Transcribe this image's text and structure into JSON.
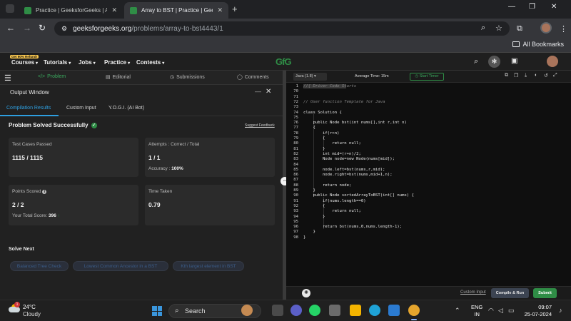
{
  "browser": {
    "tabs": [
      {
        "title": "Practice | GeeksforGeeks | A co",
        "active": false
      },
      {
        "title": "Array to BST | Practice | Geeksfo",
        "active": true
      }
    ],
    "url_domain": "geeksforgeeks.org",
    "url_path": "/problems/array-to-bst4443/1",
    "bookmarks_label": "All Bookmarks"
  },
  "site_nav": {
    "badge": "Get 90% Refund!",
    "items": [
      "Courses",
      "Tutorials",
      "Jobs",
      "Practice",
      "Contests"
    ],
    "logo": "GfG"
  },
  "problem_tabs": [
    "Problem",
    "Editorial",
    "Submissions",
    "Comments"
  ],
  "output_window": {
    "title": "Output Window",
    "tabs": [
      "Compilation Results",
      "Custom Input",
      "Y.O.G.I. (AI Bot)"
    ],
    "status": "Problem Solved Successfully",
    "feedback_link": "Suggest Feedback",
    "cards": {
      "test_cases": {
        "label": "Test Cases Passed",
        "value": "1115 / 1115"
      },
      "attempts": {
        "label": "Attempts : Correct / Total",
        "value": "1 / 1",
        "sub_label": "Accuracy :",
        "sub_value": "100%"
      },
      "points": {
        "label": "Points Scored",
        "value": "2 / 2",
        "sub_label": "Your Total Score:",
        "sub_value": "396"
      },
      "time": {
        "label": "Time Taken",
        "value": "0.79"
      }
    },
    "solve_next_title": "Solve Next",
    "solve_next": [
      "Balanced Tree Check",
      "Lowest Common Ancestor in a BST",
      "Kth largest element in BST"
    ]
  },
  "editor": {
    "language": "Java (1.8)",
    "average_time": "Average Time: 15m",
    "timer_label": "Start Timer",
    "line_numbers": [
      "1",
      "70",
      "71",
      "72",
      "73",
      "74",
      "75",
      "76",
      "77",
      "78",
      "79",
      "80",
      "81",
      "82",
      "83",
      "84",
      "85",
      "86",
      "87",
      "88",
      "89",
      "90",
      "91",
      "92",
      "93",
      "94",
      "95",
      "96",
      "97",
      "98"
    ],
    "lines": [
      "//{ Driver Code Starts",
      "",
      "",
      "// User function Template for Java",
      "",
      "class Solution {",
      "",
      "    public Node bst(int nums[],int r,int n)",
      "    {",
      "        if(r>n)",
      "        {",
      "            return null;",
      "        }",
      "        int mid=(r+n)/2;",
      "        Node node=new Node(nums[mid]);",
      "",
      "        node.left=bst(nums,r,mid);",
      "        node.right=bst(nums,mid+1,n);",
      "",
      "        return node;",
      "    }",
      "    public Node sortedArrayToBST(int[] nums) {",
      "        if(nums.length==0)",
      "        {",
      "            return null;",
      "        }",
      "",
      "        return bst(nums,0,nums.length-1);",
      "    }",
      "}"
    ],
    "custom_input": "Custom Input",
    "compile_run": "Compile & Run",
    "submit": "Submit"
  },
  "taskbar": {
    "temperature": "24°C",
    "weather": "Cloudy",
    "weather_badge": "1",
    "search": "Search",
    "language": "ENG",
    "region": "IN",
    "time": "09:07",
    "date": "25-07-2024"
  }
}
